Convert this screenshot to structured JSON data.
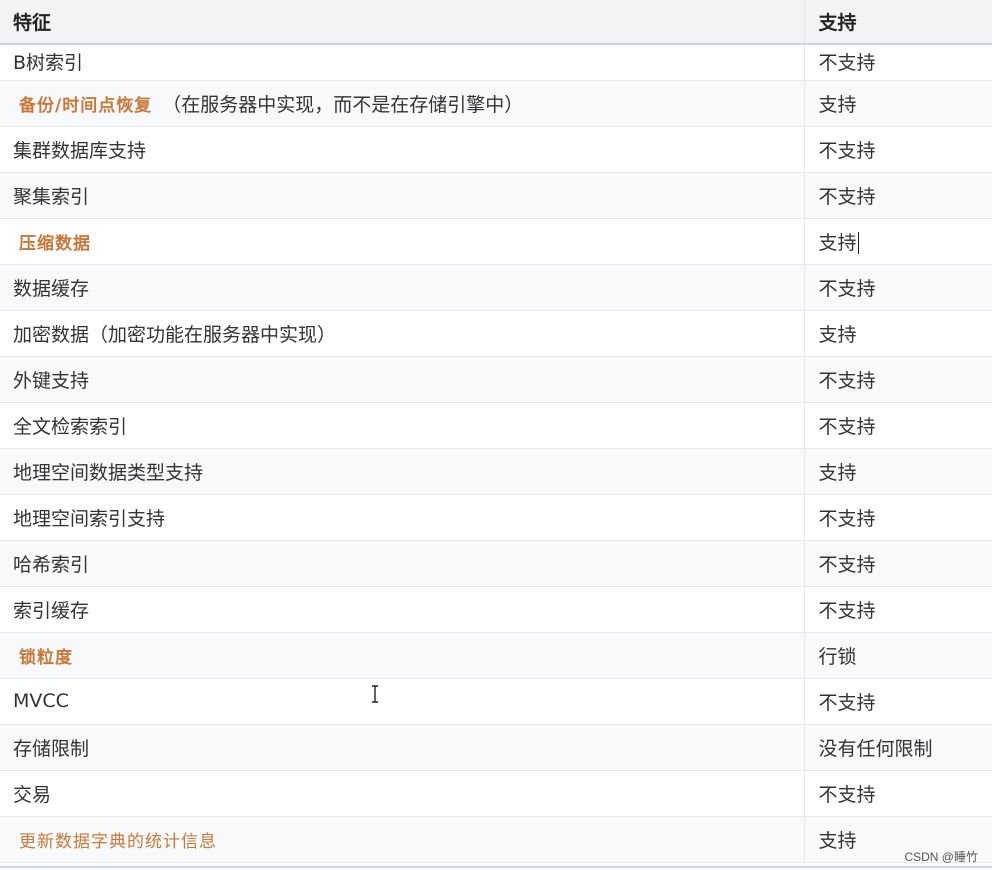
{
  "table": {
    "headers": [
      "特征",
      "支持"
    ],
    "rows": [
      {
        "feature": "B树索引",
        "value": "不支持",
        "style": "plain"
      },
      {
        "feature": "备份/时间点恢复",
        "note": "（在服务器中实现，而不是在存储引擎中）",
        "value": "支持",
        "style": "highlight"
      },
      {
        "feature": "集群数据库支持",
        "value": "不支持",
        "style": "plain"
      },
      {
        "feature": "聚集索引",
        "value": "不支持",
        "style": "plain"
      },
      {
        "feature": "压缩数据",
        "value": "支持",
        "style": "highlight"
      },
      {
        "feature": "数据缓存",
        "value": "不支持",
        "style": "plain"
      },
      {
        "feature": "加密数据（加密功能在服务器中实现）",
        "value": "支持",
        "style": "plain"
      },
      {
        "feature": "外键支持",
        "value": "不支持",
        "style": "plain"
      },
      {
        "feature": "全文检索索引",
        "value": "不支持",
        "style": "plain"
      },
      {
        "feature": "地理空间数据类型支持",
        "value": "支持",
        "style": "plain"
      },
      {
        "feature": "地理空间索引支持",
        "value": "不支持",
        "style": "plain"
      },
      {
        "feature": "哈希索引",
        "value": "不支持",
        "style": "plain"
      },
      {
        "feature": "索引缓存",
        "value": "不支持",
        "style": "plain"
      },
      {
        "feature": "锁粒度",
        "value": "行锁",
        "style": "highlight"
      },
      {
        "feature": "MVCC",
        "value": "不支持",
        "style": "plain"
      },
      {
        "feature": "存储限制",
        "value": "没有任何限制",
        "style": "plain"
      },
      {
        "feature": "交易",
        "value": "不支持",
        "style": "plain"
      },
      {
        "feature": "更新数据字典的统计信息",
        "value": "支持",
        "style": "highlight-light"
      }
    ]
  },
  "watermark": "CSDN @睡竹",
  "colors": {
    "highlight": "#c8793a",
    "header_bg": "#f2f3f5",
    "header_border": "#c8d7ee",
    "row_alt": "#f8f9fa"
  },
  "icons": {
    "cursor": "text-cursor-icon"
  }
}
